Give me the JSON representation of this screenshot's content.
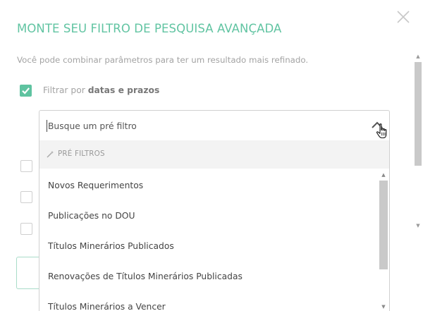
{
  "modal": {
    "title": "MONTE SEU FILTRO DE PESQUISA AVANÇADA",
    "subtitle": "Você pode combinar parâmetros para ter um resultado mais refinado."
  },
  "filters": {
    "dates": {
      "label_prefix": "Filtrar por ",
      "label_bold": "datas e prazos",
      "checked": true
    }
  },
  "prefilter": {
    "placeholder": "Busque um pré filtro",
    "header": "PRÉ FILTROS",
    "options": [
      "Novos Requerimentos",
      "Publicações no DOU",
      "Títulos Minerários Publicados",
      "Renovações de Títulos Minerários Publicadas",
      "Títulos Minerários a Vencer"
    ]
  },
  "icons": {
    "close": "close-icon",
    "check": "check-icon",
    "wand": "magic-wand-icon",
    "chevron": "chevron-up-icon",
    "cursor": "hand-pointer-icon"
  },
  "colors": {
    "accent": "#5fc3a0",
    "muted_text": "#a3a3a3",
    "header_bg": "#f3f3f3"
  }
}
